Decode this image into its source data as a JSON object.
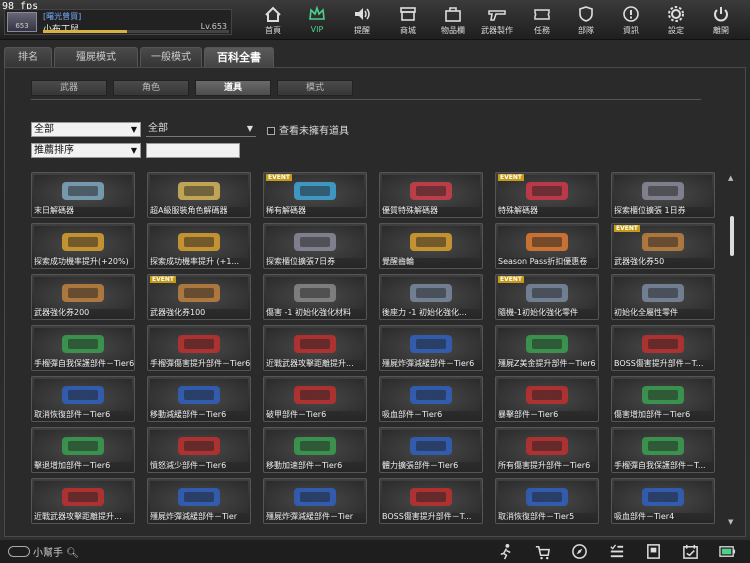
{
  "fps": "98 fps",
  "profile": {
    "rank": "653",
    "title": "[曙光曾買]",
    "name": "小布丁鼠",
    "level": "Lv.653",
    "exp_fraction": 0.45
  },
  "nav": [
    {
      "label": "首頁",
      "icon": "home-icon"
    },
    {
      "label": "VIP",
      "icon": "crown-icon"
    },
    {
      "label": "提醒",
      "icon": "speaker-icon"
    },
    {
      "label": "商城",
      "icon": "shop-icon"
    },
    {
      "label": "物品欄",
      "icon": "briefcase-icon"
    },
    {
      "label": "武器製作",
      "icon": "gun-icon"
    },
    {
      "label": "任務",
      "icon": "ticket-icon"
    },
    {
      "label": "部隊",
      "icon": "shield-icon"
    },
    {
      "label": "資訊",
      "icon": "info-icon"
    },
    {
      "label": "設定",
      "icon": "gear-icon"
    },
    {
      "label": "離開",
      "icon": "power-icon"
    }
  ],
  "tabs": [
    "排名",
    "殭屍模式",
    "一般模式",
    "百科全書"
  ],
  "subtabs": [
    "武器",
    "角色",
    "道具",
    "模式"
  ],
  "filters": {
    "category": "全部",
    "subcategory": "全部",
    "sort": "推薦排序",
    "search": "",
    "show_unowned": "查看未擁有道具"
  },
  "items": [
    {
      "label": "末日解碼器",
      "event": "",
      "color": "#7fa8c0"
    },
    {
      "label": "超A級服裝角色解碼器",
      "event": "",
      "color": "#d7b65a"
    },
    {
      "label": "稀有解碼器",
      "event": "EVENT",
      "color": "#3fa6d8"
    },
    {
      "label": "優質特殊解碼器",
      "event": "",
      "color": "#d03e4a"
    },
    {
      "label": "特殊解碼器",
      "event": "EVENT",
      "color": "#d0384a"
    },
    {
      "label": "探索櫃位擴張 1日券",
      "event": "",
      "color": "#8a8a9a"
    },
    {
      "label": "探索成功機率提升(+20%)",
      "event": "",
      "color": "#d8a030"
    },
    {
      "label": "探索成功機率提升 (+1...",
      "event": "",
      "color": "#d8a030"
    },
    {
      "label": "探索櫃位擴張7日券",
      "event": "",
      "color": "#8a8a9a"
    },
    {
      "label": "覺醒齒輪",
      "event": "",
      "color": "#d8a030"
    },
    {
      "label": "Season Pass折扣優惠卷",
      "event": "",
      "color": "#e07a30"
    },
    {
      "label": "武器強化券50",
      "event": "EVENT",
      "color": "#c08040"
    },
    {
      "label": "武器強化券200",
      "event": "",
      "color": "#c08040"
    },
    {
      "label": "武器強化券100",
      "event": "EVENT",
      "color": "#c08040"
    },
    {
      "label": "傷害 -1 初始化強化材料",
      "event": "",
      "color": "#888"
    },
    {
      "label": "後座力 -1 初始化強化...",
      "event": "",
      "color": "#7a8aa0"
    },
    {
      "label": "隨機-1初始化強化零件",
      "event": "EVENT",
      "color": "#7a8aa0"
    },
    {
      "label": "初始化全屬性零件",
      "event": "",
      "color": "#7a8aa0"
    },
    {
      "label": "手榴彈自我保護部件－Tier6",
      "event": "",
      "color": "#3aa050"
    },
    {
      "label": "手榴彈傷害提升部件－Tier6",
      "event": "",
      "color": "#c03030"
    },
    {
      "label": "近戰武器攻擊距離提升...",
      "event": "",
      "color": "#c03030"
    },
    {
      "label": "殭屍炸彈減緩部件－Tier6",
      "event": "",
      "color": "#3060c0"
    },
    {
      "label": "殭屍Z美金提升部件－Tier6",
      "event": "",
      "color": "#3aa050"
    },
    {
      "label": "BOSS傷害提升部件－T...",
      "event": "",
      "color": "#c03030"
    },
    {
      "label": "取消恢復部件－Tier6",
      "event": "",
      "color": "#3060c0"
    },
    {
      "label": "移動減緩部件－Tier6",
      "event": "",
      "color": "#3060c0"
    },
    {
      "label": "破甲部件－Tier6",
      "event": "",
      "color": "#c03030"
    },
    {
      "label": "吸血部件－Tier6",
      "event": "",
      "color": "#3060c0"
    },
    {
      "label": "暴擊部件－Tier6",
      "event": "",
      "color": "#c03030"
    },
    {
      "label": "傷害增加部件－Tier6",
      "event": "",
      "color": "#3aa050"
    },
    {
      "label": "擊退增加部件－Tier6",
      "event": "",
      "color": "#3aa050"
    },
    {
      "label": "憤怒減少部件－Tier6",
      "event": "",
      "color": "#c03030"
    },
    {
      "label": "移動加速部件－Tier6",
      "event": "",
      "color": "#3aa050"
    },
    {
      "label": "體力擴張部件－Tier6",
      "event": "",
      "color": "#3060c0"
    },
    {
      "label": "所有傷害提升部件－Tier6",
      "event": "",
      "color": "#c03030"
    },
    {
      "label": "手榴彈自我保護部件－T...",
      "event": "",
      "color": "#3aa050"
    },
    {
      "label": "近戰武器攻擊距離提升...",
      "event": "",
      "color": "#c03030"
    },
    {
      "label": "殭屍炸彈減緩部件－Tier",
      "event": "",
      "color": "#3060c0"
    },
    {
      "label": "殭屍炸彈減緩部件－Tier",
      "event": "",
      "color": "#3060c0"
    },
    {
      "label": "BOSS傷害提升部件－T...",
      "event": "",
      "color": "#c03030"
    },
    {
      "label": "取消恢復部件－Tier5",
      "event": "",
      "color": "#3060c0"
    },
    {
      "label": "吸血部件－Tier4",
      "event": "",
      "color": "#3060c0"
    }
  ],
  "helper": "小幫手",
  "bottom_icons": [
    "run-icon",
    "cart-icon",
    "compass-icon",
    "checklist-icon",
    "book-icon",
    "calendar-icon",
    "battery-icon"
  ]
}
